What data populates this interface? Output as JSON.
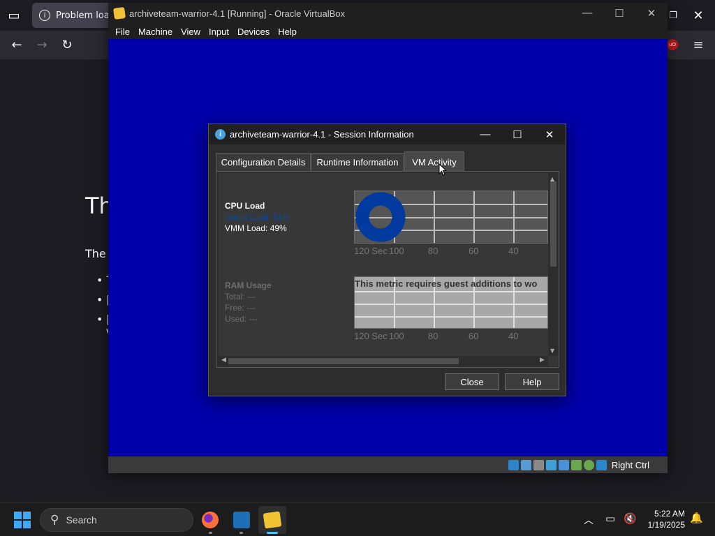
{
  "browser": {
    "tab_title": "Problem loadi",
    "content_heading": "Th",
    "content_text": "The",
    "bullets": [
      "T",
      "[",
      "["
    ],
    "extra": "V"
  },
  "vbox": {
    "title": "archiveteam-warrior-4.1 [Running] - Oracle VirtualBox",
    "menu": [
      "File",
      "Machine",
      "View",
      "Input",
      "Devices",
      "Help"
    ],
    "host_key": "Right Ctrl"
  },
  "dialog": {
    "title": "archiveteam-warrior-4.1 - Session Information",
    "tabs": [
      "Configuration Details",
      "Runtime Information",
      "VM Activity"
    ],
    "selected_tab": "VM Activity",
    "cpu": {
      "heading": "CPU Load",
      "guest_load": "Guest Load: 51%",
      "vmm_load": "VMM Load: 49%",
      "guest_percent": 51,
      "vmm_percent": 49
    },
    "ram": {
      "heading": "RAM Usage",
      "total": "Total: ---",
      "free": "Free: ---",
      "used": "Used: ---",
      "notice": "This metric requires guest additions to wo"
    },
    "axis_labels": [
      "120 Sec",
      "100",
      "80",
      "60",
      "40"
    ],
    "buttons": {
      "close": "Close",
      "help": "Help"
    }
  },
  "taskbar": {
    "search_placeholder": "Search",
    "time": "5:22 AM",
    "date": "1/19/2025"
  },
  "colors": {
    "vm_screen": "#0000aa",
    "donut": "#003a9e",
    "guest_load_text": "#0a4aa0"
  }
}
